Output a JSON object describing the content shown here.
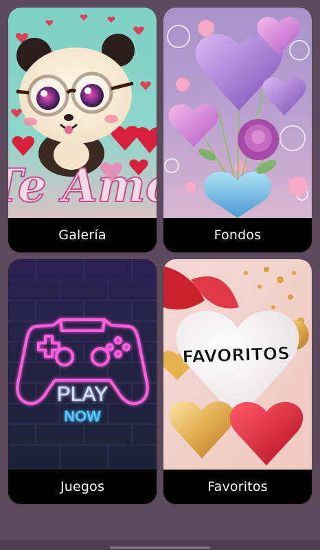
{
  "grid": {
    "items": [
      {
        "label": "Galería",
        "art_text": "Te Amo"
      },
      {
        "label": "Fondos"
      },
      {
        "label": "Juegos",
        "art_text_1": "PLAY",
        "art_text_2": "NOW"
      },
      {
        "label": "Favoritos",
        "art_text": "FAVORITOS"
      }
    ]
  },
  "colors": {
    "background": "#5d4a5d",
    "label_bar": "#000000",
    "label_text": "#ffffff",
    "neon_pink": "#ff4fd8",
    "neon_blue": "#4fc8ff"
  }
}
